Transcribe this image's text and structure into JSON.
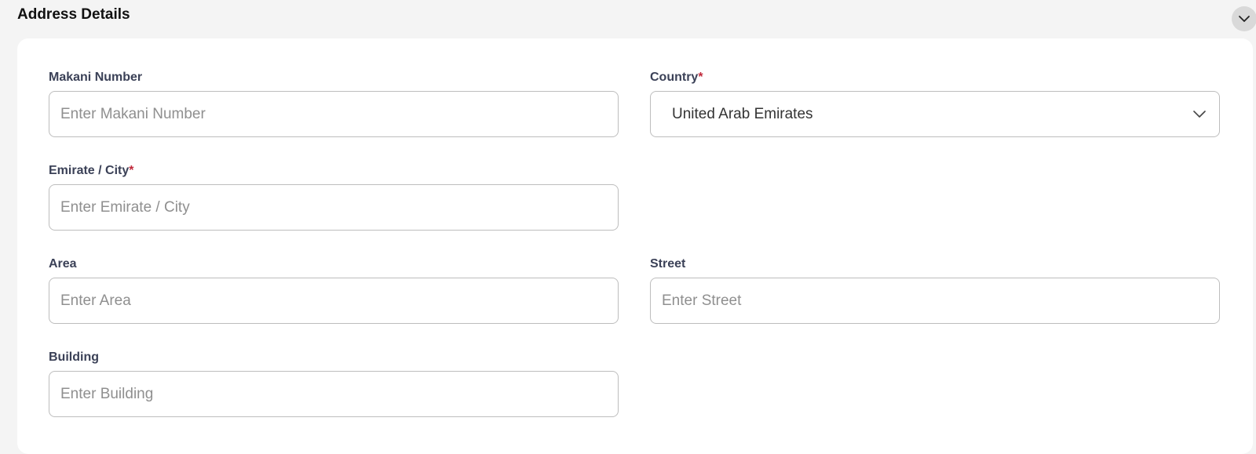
{
  "section": {
    "title": "Address Details"
  },
  "icons": {
    "collapse": "chevron-down-icon",
    "select": "chevron-down-icon"
  },
  "colors": {
    "required": "#c0283a",
    "label": "#3b4157",
    "border": "#bdbdbd"
  },
  "fields": {
    "makani": {
      "label": "Makani Number",
      "placeholder": "Enter Makani Number",
      "value": ""
    },
    "country": {
      "label": "Country",
      "required_mark": "*",
      "value": "United Arab Emirates"
    },
    "emirate": {
      "label": "Emirate / City",
      "required_mark": "*",
      "placeholder": "Enter Emirate / City",
      "value": ""
    },
    "area": {
      "label": "Area",
      "placeholder": "Enter Area",
      "value": ""
    },
    "street": {
      "label": "Street",
      "placeholder": "Enter Street",
      "value": ""
    },
    "building": {
      "label": "Building",
      "placeholder": "Enter Building",
      "value": ""
    }
  }
}
